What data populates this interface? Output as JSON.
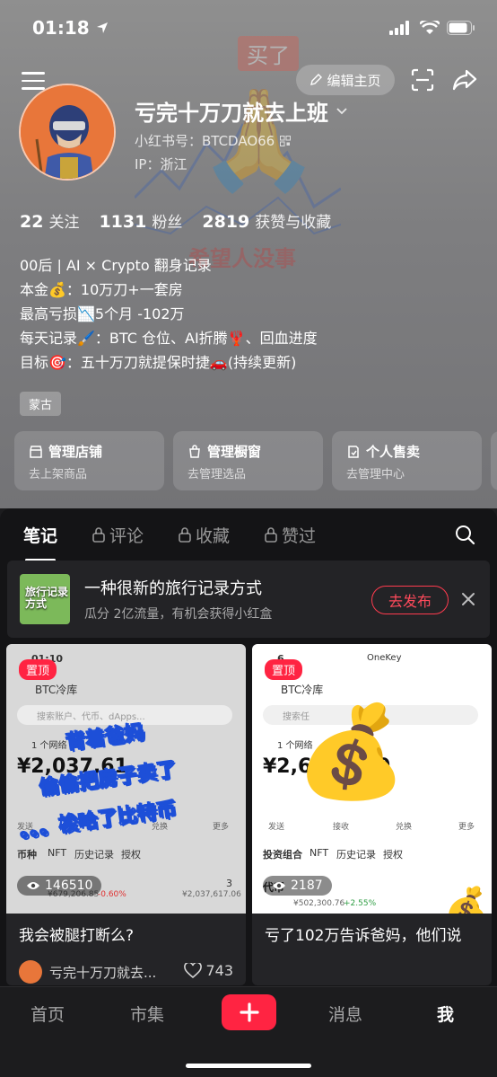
{
  "status_bar": {
    "time": "01:18"
  },
  "background_art": {
    "tag": "买了",
    "caption": "希望人没事"
  },
  "top_bar": {
    "edit_label": "编辑主页"
  },
  "profile": {
    "nickname": "亏完十万刀就去上班",
    "id_label": "小红书号：BTCDAO66",
    "ip_label": "IP：浙江",
    "stats": [
      {
        "num": "22",
        "label": "关注"
      },
      {
        "num": "1131",
        "label": "粉丝"
      },
      {
        "num": "2819",
        "label": "获赞与收藏"
      }
    ],
    "bio": [
      "00后 | AI × Crypto 翻身记录",
      "本金💰：10万刀+一套房",
      "最高亏损📉5个月 -102万",
      "每天记录🖌️：BTC 仓位、AI折腾🦞、回血进度",
      "目标🎯：五十万刀就提保时捷🚗(持续更新)"
    ],
    "location_tag": "蒙古"
  },
  "shop_cards": [
    {
      "title": "管理店铺",
      "sub": "去上架商品"
    },
    {
      "title": "管理橱窗",
      "sub": "去管理选品"
    },
    {
      "title": "个人售卖",
      "sub": "去管理中心"
    }
  ],
  "tabs": [
    "笔记",
    "评论",
    "收藏",
    "赞过"
  ],
  "promo": {
    "thumb_text": "旅行记录方式",
    "title": "一种很新的旅行记录方式",
    "sub": "瓜分 2亿流量，有机会获得小红盒",
    "button": "去发布"
  },
  "notes": [
    {
      "pin": "置顶",
      "views": "146510",
      "title": "我会被腿打断么?",
      "author": "亏完十万刀就去...",
      "likes": "743",
      "overlay": [
        "背着爸妈",
        "偷偷把房子卖了",
        "。。。梭哈了比特币"
      ],
      "mock": {
        "wallet": "BTC冷库",
        "search": "搜索账户、代币、dApps...",
        "network": "1 个网络",
        "balance": "¥2,037,61",
        "actions": [
          "发送",
          "兑换",
          "更多"
        ],
        "tabs": [
          "币种",
          "NFT",
          "历史记录",
          "授权"
        ],
        "asset_value": "¥679,206.85",
        "asset_change": "-0.60%",
        "asset_qty": "3",
        "asset_total": "¥2,037,617.06",
        "time": "01:10"
      }
    },
    {
      "pin": "置顶",
      "views": "2187",
      "title": "亏了102万告诉爸妈，他们说",
      "mock": {
        "wallet": "BTC冷库",
        "brand": "OneKey",
        "search": "搜索任",
        "network": "1 个网络",
        "balance": "¥2,6",
        "balance_tail": "49",
        "actions": [
          "发送",
          "接收",
          "兑换",
          "更多"
        ],
        "tabs": [
          "投资组合",
          "NFT",
          "历史记录",
          "授权"
        ],
        "section": "代币",
        "asset_value": "¥502,300.76",
        "asset_change": "+2.55%",
        "time": "6"
      }
    }
  ],
  "bottom_nav": [
    "首页",
    "市集",
    "消息",
    "我"
  ],
  "colors": {
    "accent": "#ff2442",
    "content_bg": "#141416"
  }
}
